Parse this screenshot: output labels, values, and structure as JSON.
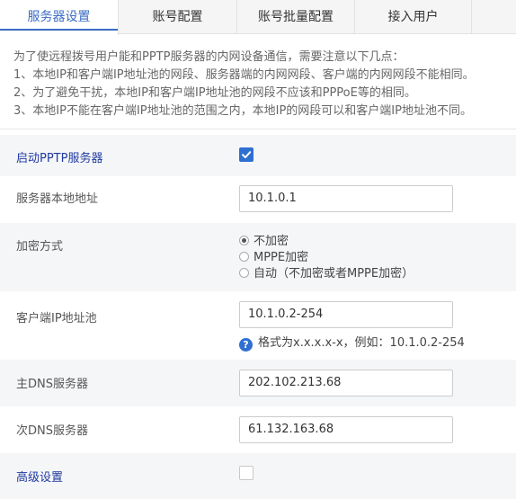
{
  "tabs": [
    {
      "label": "服务器设置"
    },
    {
      "label": "账号配置"
    },
    {
      "label": "账号批量配置"
    },
    {
      "label": "接入用户"
    }
  ],
  "note": {
    "lines": [
      "为了使远程拨号用户能和PPTP服务器的内网设备通信，需要注意以下几点：",
      "1、本地IP和客户端IP地址池的网段、服务器端的内网网段、客户端的内网网段不能相同。",
      "2、为了避免干扰，本地IP和客户端IP地址池的网段不应该和PPPoE等的相同。",
      "3、本地IP不能在客户端IP地址池的范围之内，本地IP的网段可以和客户端IP地址池不同。"
    ]
  },
  "form": {
    "enable_pptp": {
      "label": "启动PPTP服务器",
      "checked": true
    },
    "local_ip": {
      "label": "服务器本地地址",
      "value": "10.1.0.1"
    },
    "encryption": {
      "label": "加密方式",
      "options": [
        "不加密",
        "MPPE加密",
        "自动（不加密或者MPPE加密）"
      ],
      "selected": "不加密"
    },
    "ip_pool": {
      "label": "客户端IP地址池",
      "value": "10.1.0.2-254",
      "hint": "格式为x.x.x.x-x，例如：10.1.0.2-254"
    },
    "primary_dns": {
      "label": "主DNS服务器",
      "value": "202.102.213.68"
    },
    "secondary_dns": {
      "label": "次DNS服务器",
      "value": "61.132.163.68"
    },
    "advanced": {
      "label": "高级设置",
      "checked": false
    }
  },
  "icons": {
    "check": "checkmark-icon",
    "help": "question-circle-icon"
  },
  "colors": {
    "accent": "#2f6fd1",
    "tab_active": "#3a6cc4",
    "label_blue": "#1f3aa0"
  }
}
